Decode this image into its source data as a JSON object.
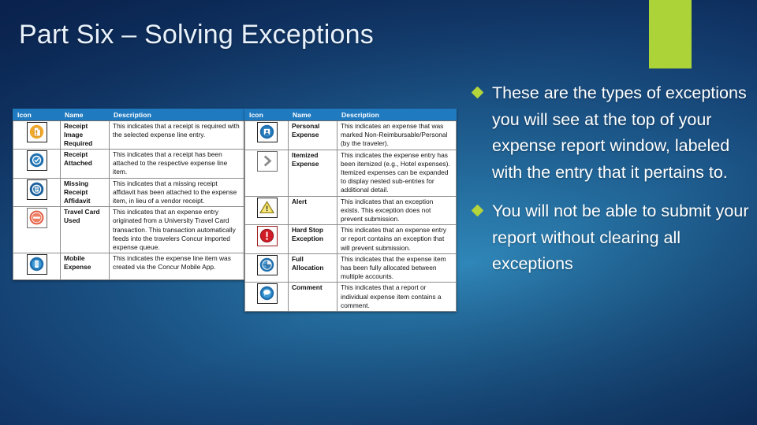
{
  "slide": {
    "title": "Part Six – Solving Exceptions",
    "accent_color": "#acd438",
    "background_color": "#1a5183",
    "header_color": "#1f7ac0"
  },
  "bullets": [
    {
      "text": "These are the types of exceptions you will see at the top of your expense report window, labeled with the entry that it pertains to."
    },
    {
      "text": "You will not be able to submit your report without clearing all exceptions"
    }
  ],
  "left_table": {
    "headers": [
      "Icon",
      "Name",
      "Description"
    ],
    "rows": [
      {
        "icon": "receipt-image-required-icon",
        "name": "Receipt Image Required",
        "description": "This indicates that a receipt is required with the selected expense line entry."
      },
      {
        "icon": "receipt-attached-icon",
        "name": "Receipt Attached",
        "description": "This indicates that a receipt has been attached to the respective expense line item."
      },
      {
        "icon": "missing-receipt-affidavit-icon",
        "name": "Missing Receipt Affidavit",
        "description": "This indicates that a missing receipt affidavit has been attached to the expense item, in lieu of a vendor receipt."
      },
      {
        "icon": "travel-card-used-icon",
        "name": "Travel Card Used",
        "description": "This indicates that an expense entry originated from a University Travel Card transaction. This transaction automatically feeds into the travelers Concur imported expense queue."
      },
      {
        "icon": "mobile-expense-icon",
        "name": "Mobile Expense",
        "description": "This indicates the expense line item was created via the Concur Mobile App."
      }
    ]
  },
  "right_table": {
    "headers": [
      "Icon",
      "Name",
      "Description"
    ],
    "rows": [
      {
        "icon": "personal-expense-icon",
        "name": "Personal Expense",
        "description": "This indicates an expense that was marked Non-Reimbursable/Personal (by the traveler)."
      },
      {
        "icon": "itemized-expense-icon",
        "name": "Itemized Expense",
        "description": "This indicates the expense entry has been itemized (e.g., Hotel expenses).  Itemized expenses can be expanded to display nested sub-entries for additional detail."
      },
      {
        "icon": "alert-icon",
        "name": "Alert",
        "description": "This indicates that an exception exists. This exception does not prevent submission."
      },
      {
        "icon": "hard-stop-exception-icon",
        "name": "Hard Stop Exception",
        "description": "This indicates that an expense entry or report contains an exception that will prevent submission."
      },
      {
        "icon": "full-allocation-icon",
        "name": "Full Allocation",
        "description": "This indicates that the expense item has been fully allocated between multiple accounts."
      },
      {
        "icon": "comment-icon",
        "name": "Comment",
        "description": "This indicates that a report or individual expense item contains a comment."
      }
    ]
  }
}
